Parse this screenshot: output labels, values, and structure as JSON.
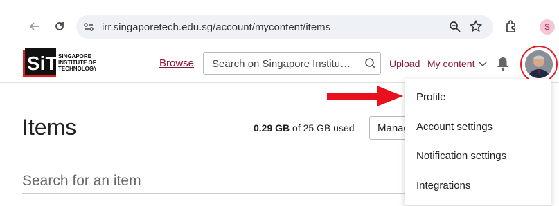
{
  "browser": {
    "url": "irr.singaporetech.edu.sg/account/mycontent/items",
    "profile_initial": "S",
    "icons": [
      "back-arrow-icon",
      "reload-icon",
      "site-info-icon",
      "zoom-icon",
      "bookmark-star-icon",
      "extensions-icon"
    ]
  },
  "header": {
    "logo_text": "SiT",
    "logo_line1": "SINGAPORE",
    "logo_line2": "INSTITUTE OF",
    "logo_line3": "TECHNOLOGY",
    "browse_label": "Browse",
    "search_placeholder": "Search on Singapore Institu…",
    "upload_label": "Upload",
    "mycontent_label": "My content"
  },
  "main": {
    "title": "Items",
    "usage_used": "0.29 GB",
    "usage_rest": " of 25 GB used",
    "manage_label": "Manag",
    "search_placeholder": "Search for an item"
  },
  "dropdown": {
    "items": [
      "Profile",
      "Account settings",
      "Notification settings",
      "Integrations"
    ]
  },
  "colors": {
    "brand": "#8c1538",
    "highlight": "#e31b23",
    "omnibox": "#eef1f6"
  }
}
